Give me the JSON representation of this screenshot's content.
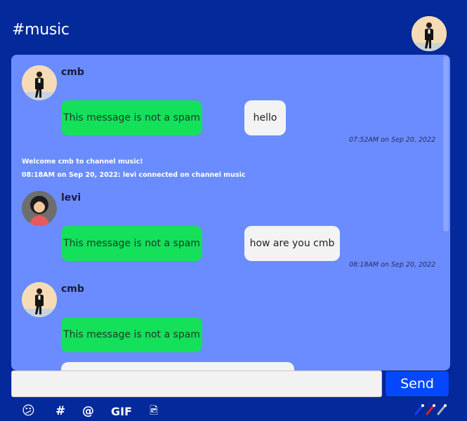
{
  "header": {
    "title": "#music",
    "avatar_icon": "user-avatar-icon"
  },
  "messages": [
    {
      "username": "cmb",
      "spam_label": "This message is not a spam",
      "text": "hello",
      "timestamp": "07:52AM on Sep 20, 2022"
    },
    {
      "username": "levi",
      "spam_label": "This message is not a spam",
      "text": "how are you cmb",
      "timestamp": "08:18AM on Sep 20, 2022"
    },
    {
      "username": "cmb",
      "spam_label": "This message is not a spam",
      "text": "",
      "timestamp": ""
    }
  ],
  "system_messages": [
    "Welcome cmb to channel music!",
    "08:18AM on Sep 20, 2022: levi connected on channel music"
  ],
  "composer": {
    "placeholder": "",
    "send_label": "Send"
  },
  "toolbar": {
    "emoji": "😕",
    "hash": "#",
    "at": "@",
    "gif": "GIF",
    "image_icon": "🖻"
  },
  "colors": {
    "background": "#03299a",
    "chat_panel": "#6a8cff",
    "spam_badge": "#14e05a",
    "send_button": "#0447ff"
  }
}
